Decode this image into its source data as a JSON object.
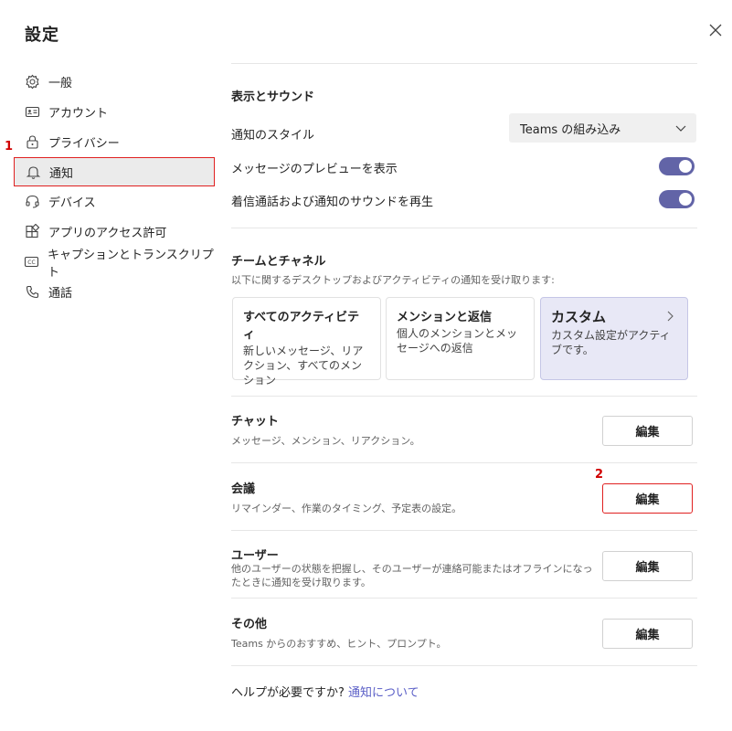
{
  "header": {
    "title": "設定"
  },
  "sidebar": {
    "items": [
      {
        "label": "一般",
        "icon": "gear-icon"
      },
      {
        "label": "アカウント",
        "icon": "id-card-icon"
      },
      {
        "label": "プライバシー",
        "icon": "lock-icon"
      },
      {
        "label": "通知",
        "icon": "bell-icon",
        "active": true
      },
      {
        "label": "デバイス",
        "icon": "headset-icon"
      },
      {
        "label": "アプリのアクセス許可",
        "icon": "apps-icon"
      },
      {
        "label": "キャプションとトランスクリプト",
        "icon": "cc-icon"
      },
      {
        "label": "通話",
        "icon": "phone-icon"
      }
    ]
  },
  "annotations": {
    "one": "1",
    "two": "2"
  },
  "display": {
    "heading": "表示とサウンド",
    "style_label": "通知のスタイル",
    "style_value": "Teams の組み込み",
    "preview_label": "メッセージのプレビューを表示",
    "sound_label": "着信通話および通知のサウンドを再生"
  },
  "teams": {
    "heading": "チームとチャネル",
    "description": "以下に関するデスクトップおよびアクティビティの通知を受け取ります:",
    "cards": [
      {
        "title": "すべてのアクティビティ",
        "desc": "新しいメッセージ、リアクション、すべてのメンション"
      },
      {
        "title": "メンションと返信",
        "desc": "個人のメンションとメッセージへの返信"
      },
      {
        "title": "カスタム",
        "desc": "カスタム設定がアクティブです。"
      }
    ]
  },
  "sections": [
    {
      "title": "チャット",
      "desc": "メッセージ、メンション、リアクション。",
      "button": "編集"
    },
    {
      "title": "会議",
      "desc": "リマインダー、作業のタイミング、予定表の設定。",
      "button": "編集"
    },
    {
      "title": "ユーザー",
      "desc": "他のユーザーの状態を把握し、そのユーザーが連絡可能またはオフラインになったときに通知を受け取ります。",
      "button": "編集"
    },
    {
      "title": "その他",
      "desc": "Teams からのおすすめ、ヒント、プロンプト。",
      "button": "編集"
    }
  ],
  "help": {
    "question": "ヘルプが必要ですか?",
    "link": "通知について"
  },
  "colors": {
    "accent": "#6264a7",
    "link": "#5b5fc7",
    "highlight": "#e02020"
  }
}
